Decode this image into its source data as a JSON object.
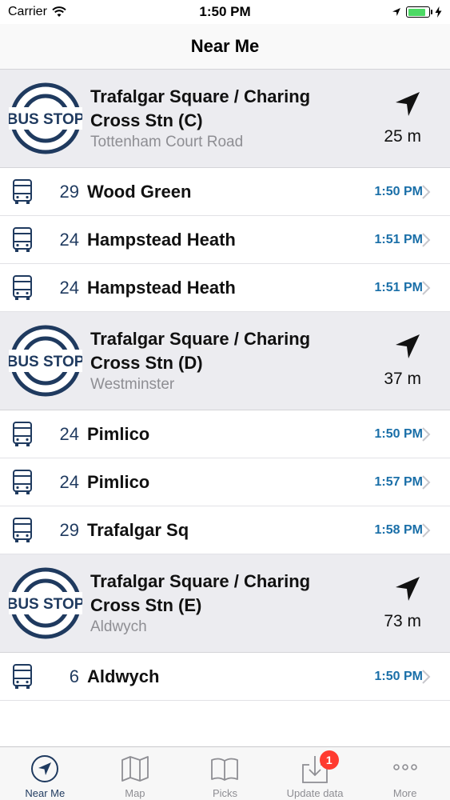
{
  "status_bar": {
    "carrier": "Carrier",
    "time": "1:50 PM",
    "battery_level": 0.85
  },
  "nav": {
    "title": "Near Me"
  },
  "icons": {
    "bus_stop_logo_text": "BUS STOP",
    "route_icon": "bus-icon",
    "direction_icon": "location-arrow-icon",
    "row_chevron": "chevron-right-icon"
  },
  "stops": [
    {
      "name_line1": "Trafalgar Square / Charing",
      "name_line2": "Cross Stn (C)",
      "subtitle": "Tottenham Court Road",
      "distance": "25 m",
      "routes": [
        {
          "number": "29",
          "destination": "Wood Green",
          "time": "1:50 PM"
        },
        {
          "number": "24",
          "destination": "Hampstead Heath",
          "time": "1:51 PM"
        },
        {
          "number": "24",
          "destination": "Hampstead Heath",
          "time": "1:51 PM"
        }
      ]
    },
    {
      "name_line1": "Trafalgar Square / Charing",
      "name_line2": "Cross Stn (D)",
      "subtitle": "Westminster",
      "distance": "37 m",
      "routes": [
        {
          "number": "24",
          "destination": "Pimlico",
          "time": "1:50 PM"
        },
        {
          "number": "24",
          "destination": "Pimlico",
          "time": "1:57 PM"
        },
        {
          "number": "29",
          "destination": "Trafalgar Sq",
          "time": "1:58 PM"
        }
      ]
    },
    {
      "name_line1": "Trafalgar Square / Charing",
      "name_line2": "Cross Stn (E)",
      "subtitle": "Aldwych",
      "distance": "73 m",
      "routes": [
        {
          "number": "6",
          "destination": "Aldwych",
          "time": "1:50 PM"
        }
      ]
    }
  ],
  "tabs": [
    {
      "label": "Near Me",
      "icon": "location-arrow-icon",
      "active": true
    },
    {
      "label": "Map",
      "icon": "map-icon",
      "active": false
    },
    {
      "label": "Picks",
      "icon": "book-icon",
      "active": false
    },
    {
      "label": "Update data",
      "icon": "download-icon",
      "active": false,
      "badge": "1"
    },
    {
      "label": "More",
      "icon": "more-dots-icon",
      "active": false
    }
  ],
  "colors": {
    "accent": "#1f3a5f",
    "time_blue": "#1a6fa8",
    "header_bg": "#ececf0",
    "badge": "#ff3b30",
    "battery": "#4cd964"
  }
}
